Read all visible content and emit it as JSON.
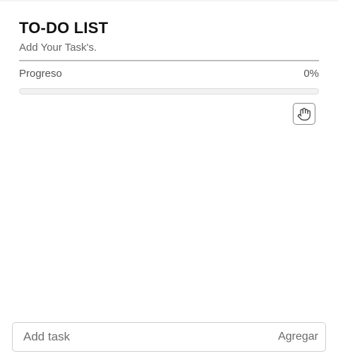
{
  "header": {
    "title": "TO-DO LIST",
    "subtitle": "Add Your Task's."
  },
  "progress": {
    "label": "Progreso",
    "percent_text": "0%",
    "value": 0
  },
  "toolbar": {
    "hand_icon": "hand-icon"
  },
  "tasks": [],
  "input": {
    "placeholder": "Add task",
    "value": "",
    "add_label": "Agregar"
  }
}
